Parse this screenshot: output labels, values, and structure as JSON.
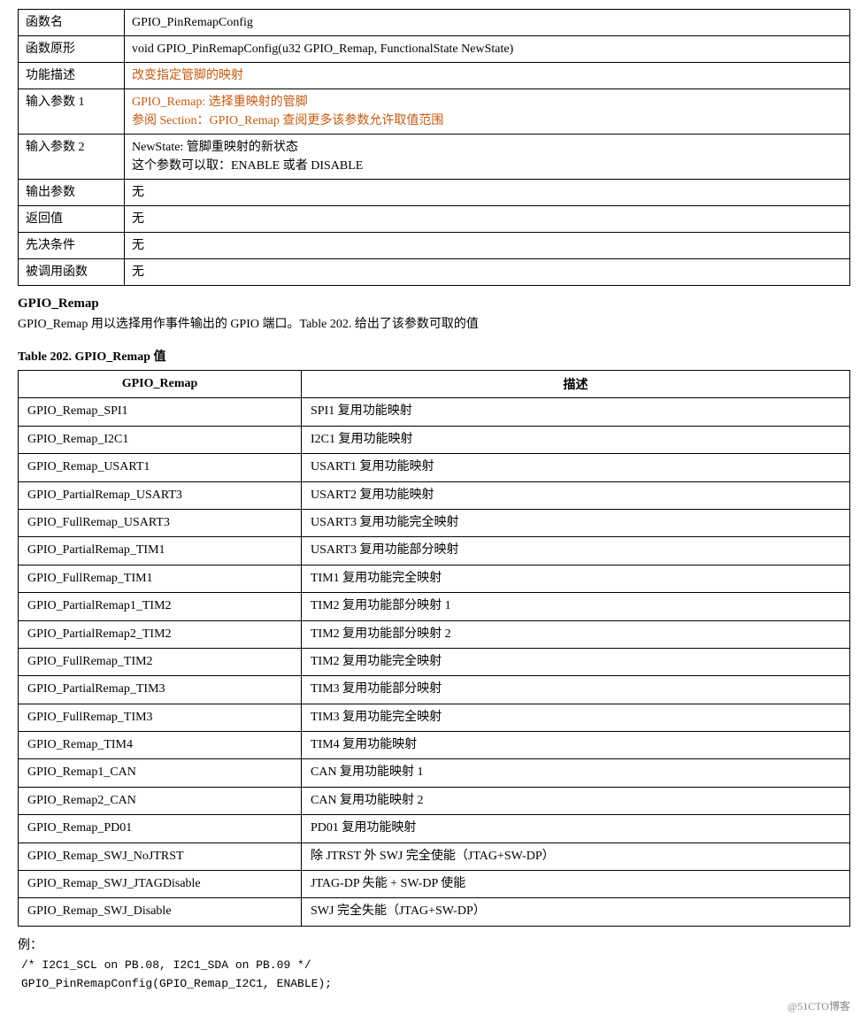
{
  "func_table": {
    "rows": [
      {
        "label": "函数名",
        "value": "GPIO_PinRemapConfig",
        "orange": false
      },
      {
        "label": "函数原形",
        "value": "void GPIO_PinRemapConfig(u32 GPIO_Remap, FunctionalState NewState)",
        "orange": false
      },
      {
        "label": "功能描述",
        "value": "改变指定管脚的映射",
        "orange": true
      },
      {
        "label": "输入参数 1",
        "value": "GPIO_Remap: 选择重映射的管脚\n参阅 Section：GPIO_Remap 查阅更多该参数允许取值范围",
        "orange": true
      },
      {
        "label": "输入参数 2",
        "value": "NewState: 管脚重映射的新状态\n这个参数可以取：ENABLE 或者 DISABLE",
        "orange": false
      },
      {
        "label": "输出参数",
        "value": "无",
        "orange": false
      },
      {
        "label": "返回值",
        "value": "无",
        "orange": false
      },
      {
        "label": "先决条件",
        "value": "无",
        "orange": false
      },
      {
        "label": "被调用函数",
        "value": "无",
        "orange": false
      }
    ]
  },
  "section": {
    "heading": "GPIO_Remap",
    "desc": "GPIO_Remap 用以选择用作事件输出的 GPIO 端口。Table 202. 给出了该参数可取的值"
  },
  "remap_table": {
    "title": "Table 202. GPIO_Remap 值",
    "col1": "GPIO_Remap",
    "col2": "描述",
    "rows": [
      {
        "name": "GPIO_Remap_SPI1",
        "desc": "SPI1 复用功能映射"
      },
      {
        "name": "GPIO_Remap_I2C1",
        "desc": "I2C1 复用功能映射"
      },
      {
        "name": "GPIO_Remap_USART1",
        "desc": "USART1 复用功能映射"
      },
      {
        "name": "GPIO_PartialRemap_USART3",
        "desc": "USART2 复用功能映射"
      },
      {
        "name": "GPIO_FullRemap_USART3",
        "desc": "USART3 复用功能完全映射"
      },
      {
        "name": "GPIO_PartialRemap_TIM1",
        "desc": "USART3 复用功能部分映射"
      },
      {
        "name": "GPIO_FullRemap_TIM1",
        "desc": "TIM1 复用功能完全映射"
      },
      {
        "name": "GPIO_PartialRemap1_TIM2",
        "desc": "TIM2 复用功能部分映射 1"
      },
      {
        "name": "GPIO_PartialRemap2_TIM2",
        "desc": "TIM2 复用功能部分映射 2"
      },
      {
        "name": "GPIO_FullRemap_TIM2",
        "desc": "TIM2 复用功能完全映射"
      },
      {
        "name": "GPIO_PartialRemap_TIM3",
        "desc": "TIM3 复用功能部分映射"
      },
      {
        "name": "GPIO_FullRemap_TIM3",
        "desc": "TIM3 复用功能完全映射"
      },
      {
        "name": "GPIO_Remap_TIM4",
        "desc": "TIM4 复用功能映射"
      },
      {
        "name": "GPIO_Remap1_CAN",
        "desc": "CAN 复用功能映射 1"
      },
      {
        "name": "GPIO_Remap2_CAN",
        "desc": "CAN 复用功能映射 2"
      },
      {
        "name": "GPIO_Remap_PD01",
        "desc": "PD01 复用功能映射"
      },
      {
        "name": "GPIO_Remap_SWJ_NoJTRST",
        "desc": "除 JTRST 外 SWJ 完全使能（JTAG+SW-DP）"
      },
      {
        "name": "GPIO_Remap_SWJ_JTAGDisable",
        "desc": "JTAG-DP 失能 + SW-DP 使能"
      },
      {
        "name": "GPIO_Remap_SWJ_Disable",
        "desc": "SWJ 完全失能（JTAG+SW-DP）"
      }
    ]
  },
  "example": {
    "label": "例：",
    "code_line1": "/* I2C1_SCL on PB.08, I2C1_SDA on PB.09 */",
    "code_line2": "GPIO_PinRemapConfig(GPIO_Remap_I2C1, ENABLE);"
  },
  "footer": "@51CTO博客"
}
